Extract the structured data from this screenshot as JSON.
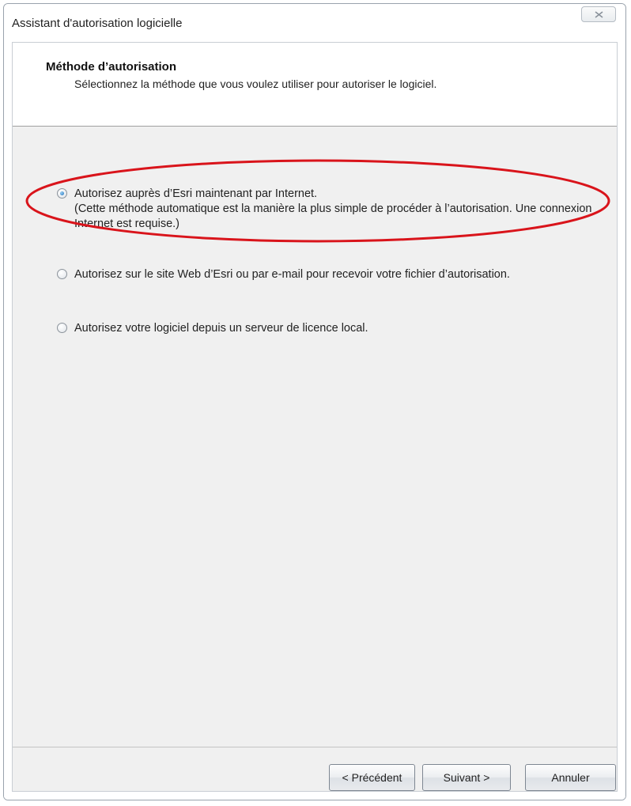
{
  "window": {
    "title": "Assistant d'autorisation logicielle",
    "close_icon": "close-x-icon"
  },
  "header": {
    "title": "Méthode d’autorisation",
    "subtitle": "Sélectionnez la méthode que vous voulez utiliser pour autoriser le logiciel."
  },
  "options": [
    {
      "label": "Autorisez auprès d’Esri maintenant par Internet.",
      "description": "(Cette méthode automatique est la manière la plus simple de procéder à l’autorisation. Une connexion Internet est requise.)",
      "selected": true
    },
    {
      "label": "Autorisez sur le site Web d’Esri ou par e-mail pour recevoir votre fichier d’autorisation.",
      "selected": false
    },
    {
      "label": "Autorisez votre logiciel depuis un serveur de licence local.",
      "selected": false
    }
  ],
  "buttons": {
    "previous": "< Précédent",
    "next": "Suivant >",
    "cancel": "Annuler"
  },
  "colors": {
    "highlight_ellipse": "#d9141b",
    "radio_selected": "#1e6fb8"
  }
}
